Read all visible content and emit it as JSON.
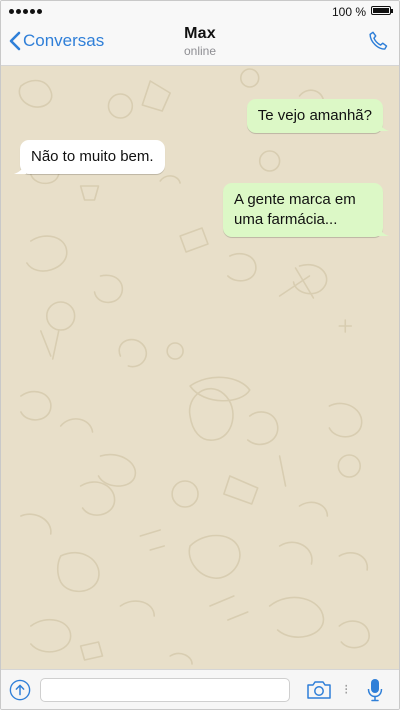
{
  "status_bar": {
    "battery_percent": "100 %",
    "signal_dots": 5,
    "battery_level": 1.0
  },
  "header": {
    "back_label": "Conversas",
    "contact_name": "Max",
    "contact_status": "online"
  },
  "messages": [
    {
      "direction": "outgoing",
      "text": "Te vejo amanhã?"
    },
    {
      "direction": "incoming",
      "text": "Não to muito bem."
    },
    {
      "direction": "outgoing",
      "text": "A gente marca em uma farmácia..."
    }
  ],
  "composer": {
    "value": "",
    "placeholder": ""
  },
  "icons": {
    "back": "chevron-left-icon",
    "call": "phone-icon",
    "upload": "arrow-up-circle-icon",
    "camera": "camera-icon",
    "mic": "microphone-icon"
  },
  "colors": {
    "accent": "#2f7fd8",
    "outgoing_bubble": "#dcf8c6",
    "incoming_bubble": "#ffffff",
    "chat_background": "#e8dfc9"
  }
}
